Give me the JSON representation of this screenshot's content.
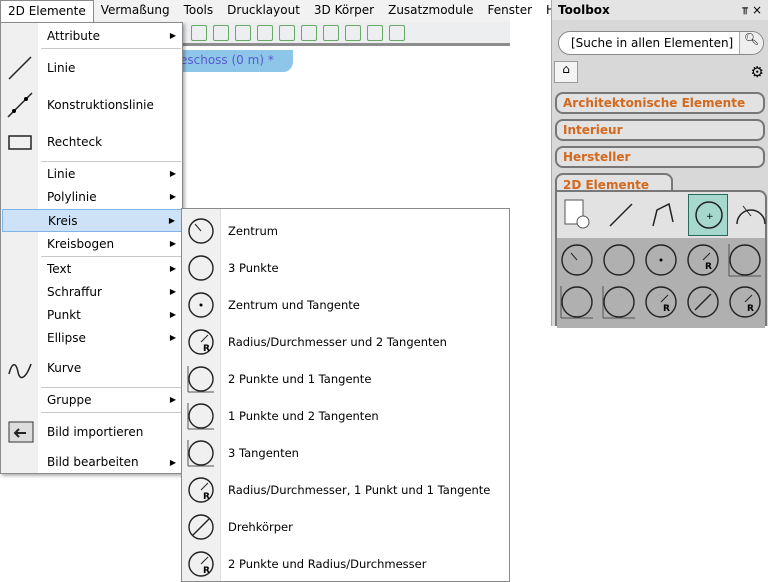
{
  "menubar": {
    "items": [
      "2D Elemente",
      "Vermaßung",
      "Tools",
      "Drucklayout",
      "3D Körper",
      "Zusatzmodule",
      "Fenster",
      "H"
    ]
  },
  "document_tab": "eschoss (0 m) *",
  "main_menu": {
    "items": [
      "Attribute",
      "Linie",
      "Konstruktionslinie",
      "Rechteck",
      "Linie",
      "Polylinie",
      "Kreis",
      "Kreisbogen",
      "Text",
      "Schraffur",
      "Punkt",
      "Ellipse",
      "Kurve",
      "Gruppe",
      "Bild importieren",
      "Bild bearbeiten"
    ],
    "highlighted": "Kreis"
  },
  "submenu": {
    "items": [
      "Zentrum",
      "3 Punkte",
      "Zentrum und Tangente",
      "Radius/Durchmesser und 2 Tangenten",
      "2 Punkte und 1 Tangente",
      "1 Punkte und 2 Tangenten",
      "3 Tangenten",
      "Radius/Durchmesser, 1 Punkt und 1 Tangente",
      "Drehkörper",
      "2 Punkte und Radius/Durchmesser"
    ]
  },
  "toolbox": {
    "title": "Toolbox",
    "pin": "⫪",
    "close": "×",
    "search_placeholder": "[Suche in allen Elementen]",
    "categories": [
      "Architektonische Elemente",
      "Interieur",
      "Hersteller"
    ],
    "active_tab": "2D Elemente",
    "accent": "#d2691e"
  }
}
